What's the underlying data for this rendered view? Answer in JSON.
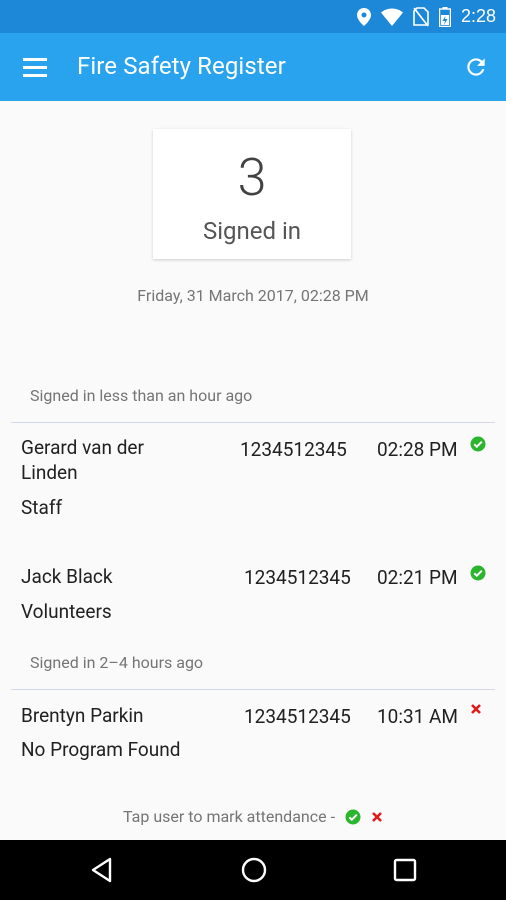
{
  "status_bar": {
    "time": "2:28"
  },
  "app_bar": {
    "title": "Fire Safety Register"
  },
  "summary": {
    "count": "3",
    "label": "Signed in",
    "datetime": "Friday, 31 March 2017, 02:28 PM"
  },
  "groups": [
    {
      "header": "Signed in less than an hour ago",
      "rows": [
        {
          "name_line1": "Gerard van der",
          "name_line2": "Linden",
          "program": "Staff",
          "phone": "1234512345",
          "time": "02:28 PM",
          "status": "present"
        },
        {
          "name_line1": "Jack Black",
          "program": "Volunteers",
          "phone": "1234512345",
          "time": "02:21 PM",
          "status": "present"
        }
      ]
    },
    {
      "header": "Signed in 2–4 hours ago",
      "rows": [
        {
          "name_line1": "Brentyn Parkin",
          "program": "No Program Found",
          "phone": "1234512345",
          "time": "10:31 AM",
          "status": "absent"
        }
      ]
    }
  ],
  "footer": {
    "hint": "Tap user to mark attendance -"
  },
  "colors": {
    "status_bar": "#1e88d8",
    "app_bar": "#29a3ee",
    "check": "#2bb52f",
    "cross": "#e01c1c"
  },
  "icons": [
    "location-icon",
    "wifi-icon",
    "no-sim-icon",
    "battery-icon",
    "menu-icon",
    "refresh-icon",
    "check-icon",
    "cross-icon",
    "back-icon",
    "home-icon",
    "recents-icon"
  ]
}
